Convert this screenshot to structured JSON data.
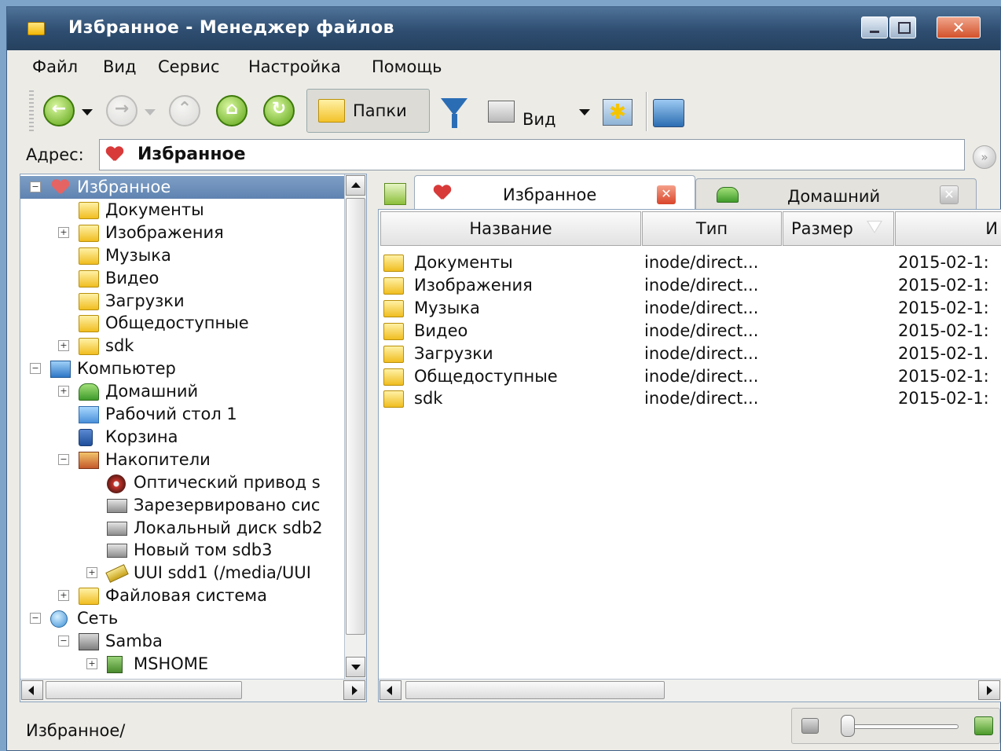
{
  "window": {
    "title": "Избранное - Менеджер файлов",
    "close_glyph": "✕"
  },
  "menu": [
    "Файл",
    "Вид",
    "Сервис",
    "Настройка",
    "Помощь"
  ],
  "toolbar": {
    "folders_label": "Папки",
    "view_label": "Вид",
    "back_glyph": "←",
    "forward_glyph": "→",
    "up_glyph": "⌃",
    "home_glyph": "⌂",
    "refresh_glyph": "↻",
    "star_glyph": "✱"
  },
  "address": {
    "label": "Адрес:",
    "value": "Избранное",
    "go_glyph": "»"
  },
  "tree": [
    {
      "label": "Избранное",
      "level": 0,
      "icon": "heart-icon",
      "expander": "−",
      "selected": true
    },
    {
      "label": "Документы",
      "level": 1,
      "icon": "folder-documents-icon",
      "expander": ""
    },
    {
      "label": "Изображения",
      "level": 1,
      "icon": "folder-images-icon",
      "expander": "+"
    },
    {
      "label": "Музыка",
      "level": 1,
      "icon": "folder-music-icon",
      "expander": ""
    },
    {
      "label": "Видео",
      "level": 1,
      "icon": "folder-video-icon",
      "expander": ""
    },
    {
      "label": "Загрузки",
      "level": 1,
      "icon": "folder-downloads-icon",
      "expander": ""
    },
    {
      "label": "Общедоступные",
      "level": 1,
      "icon": "folder-public-icon",
      "expander": ""
    },
    {
      "label": "sdk",
      "level": 1,
      "icon": "folder-icon",
      "expander": "+"
    },
    {
      "label": "Компьютер",
      "level": 0,
      "icon": "computer-icon",
      "expander": "−"
    },
    {
      "label": "Домашний",
      "level": 1,
      "icon": "home-icon",
      "expander": "+"
    },
    {
      "label": "Рабочий стол 1",
      "level": 1,
      "icon": "desktop-icon",
      "expander": ""
    },
    {
      "label": "Корзина",
      "level": 1,
      "icon": "trash-icon",
      "expander": ""
    },
    {
      "label": "Накопители",
      "level": 1,
      "icon": "drives-icon",
      "expander": "−"
    },
    {
      "label": "Оптический привод s",
      "level": 2,
      "icon": "optical-disc-icon",
      "expander": ""
    },
    {
      "label": "Зарезервировано сис",
      "level": 2,
      "icon": "hard-drive-icon",
      "expander": ""
    },
    {
      "label": "Локальный диск sdb2",
      "level": 2,
      "icon": "hard-drive-icon",
      "expander": ""
    },
    {
      "label": "Новый том sdb3",
      "level": 2,
      "icon": "hard-drive-icon",
      "expander": ""
    },
    {
      "label": "UUI sdd1 (/media/UUI",
      "level": 2,
      "icon": "usb-drive-icon",
      "expander": "+"
    },
    {
      "label": "Файловая система",
      "level": 1,
      "icon": "folder-icon",
      "expander": "+"
    },
    {
      "label": "Сеть",
      "level": 0,
      "icon": "globe-icon",
      "expander": "−"
    },
    {
      "label": "Samba",
      "level": 1,
      "icon": "samba-icon",
      "expander": "−"
    },
    {
      "label": "MSHOME",
      "level": 2,
      "icon": "server-icon",
      "expander": "+"
    }
  ],
  "tabs": [
    {
      "label": "Избранное",
      "active": true
    },
    {
      "label": "Домашний",
      "active": false
    }
  ],
  "columns": [
    "Название",
    "Тип",
    "Размер",
    "И"
  ],
  "files": [
    {
      "name": "Документы",
      "type": "inode/direct...",
      "size": "",
      "date": "2015-02-1:",
      "icon": "folder-documents-icon"
    },
    {
      "name": "Изображения",
      "type": "inode/direct...",
      "size": "",
      "date": "2015-02-1:",
      "icon": "folder-images-icon"
    },
    {
      "name": "Музыка",
      "type": "inode/direct...",
      "size": "",
      "date": "2015-02-1:",
      "icon": "folder-music-icon"
    },
    {
      "name": "Видео",
      "type": "inode/direct...",
      "size": "",
      "date": "2015-02-1:",
      "icon": "folder-video-icon"
    },
    {
      "name": "Загрузки",
      "type": "inode/direct...",
      "size": "",
      "date": "2015-02-1.",
      "icon": "folder-downloads-icon"
    },
    {
      "name": "Общедоступные",
      "type": "inode/direct...",
      "size": "",
      "date": "2015-02-1:",
      "icon": "folder-public-icon"
    },
    {
      "name": "sdk",
      "type": "inode/direct...",
      "size": "",
      "date": "2015-02-1:",
      "icon": "folder-icon"
    }
  ],
  "status": {
    "path": "Избранное/",
    "zoom_level": 0.0
  }
}
